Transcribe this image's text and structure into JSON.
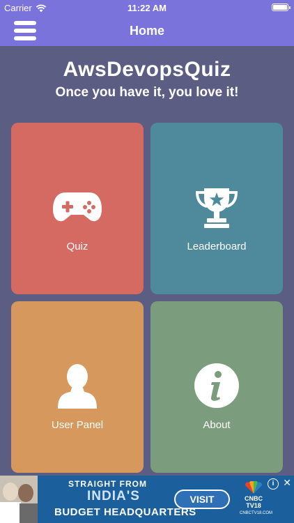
{
  "status_bar": {
    "carrier": "Carrier",
    "time": "11:22 AM",
    "wifi_icon": "wifi-icon",
    "battery_icon": "battery-icon"
  },
  "nav": {
    "title": "Home",
    "menu_icon": "hamburger-menu-icon"
  },
  "header": {
    "title": "AwsDevopsQuiz",
    "subtitle": "Once you have it, you love it!"
  },
  "tiles": [
    {
      "label": "Quiz",
      "icon": "gamepad-icon",
      "color": "#d56a62"
    },
    {
      "label": "Leaderboard",
      "icon": "trophy-icon",
      "color": "#4f8a9c"
    },
    {
      "label": "User Panel",
      "icon": "user-icon",
      "color": "#d6985c"
    },
    {
      "label": "About",
      "icon": "info-icon",
      "color": "#7b9c7d"
    }
  ],
  "ad": {
    "line1": "STRAIGHT FROM",
    "line2": "INDIA'S",
    "line3": "BUDGET HEADQUARTERS",
    "cta": "VISIT",
    "logo_name": "CNBC TV18",
    "logo_url": "CNBCTV18.COM",
    "info_glyph": "i",
    "close_glyph": "✕"
  },
  "colors": {
    "accent": "#7b73dc",
    "background": "#5b5d83"
  }
}
